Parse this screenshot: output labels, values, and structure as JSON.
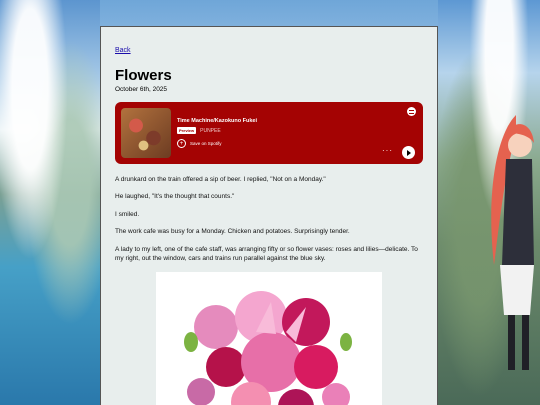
{
  "page": {
    "back": "Back",
    "title": "Flowers",
    "date": "October 6th, 2025"
  },
  "spotify": {
    "song": "Time Machine/Kazokuno Fukei",
    "badge": "Preview",
    "artist": "PUNPEE",
    "save": "Save on Spotify",
    "more": "···"
  },
  "paragraphs": [
    "A drunkard on the train offered a sip of beer. I replied, \"Not on a Monday.\"",
    "He laughed, \"It's the thought that counts.\"",
    "I smiled.",
    "The work cafe was busy for a Monday. Chicken and potatoes. Surprisingly tender.",
    "A lady to my left, one of the cafe staff, was arranging fifty or so flower vases: roses and lilies—delicate. To my right, out the window, cars and trains run parallel against the blue sky."
  ],
  "colors": {
    "accent": "#a40303",
    "link": "#1a0dab",
    "panel": "#e8eeed"
  }
}
